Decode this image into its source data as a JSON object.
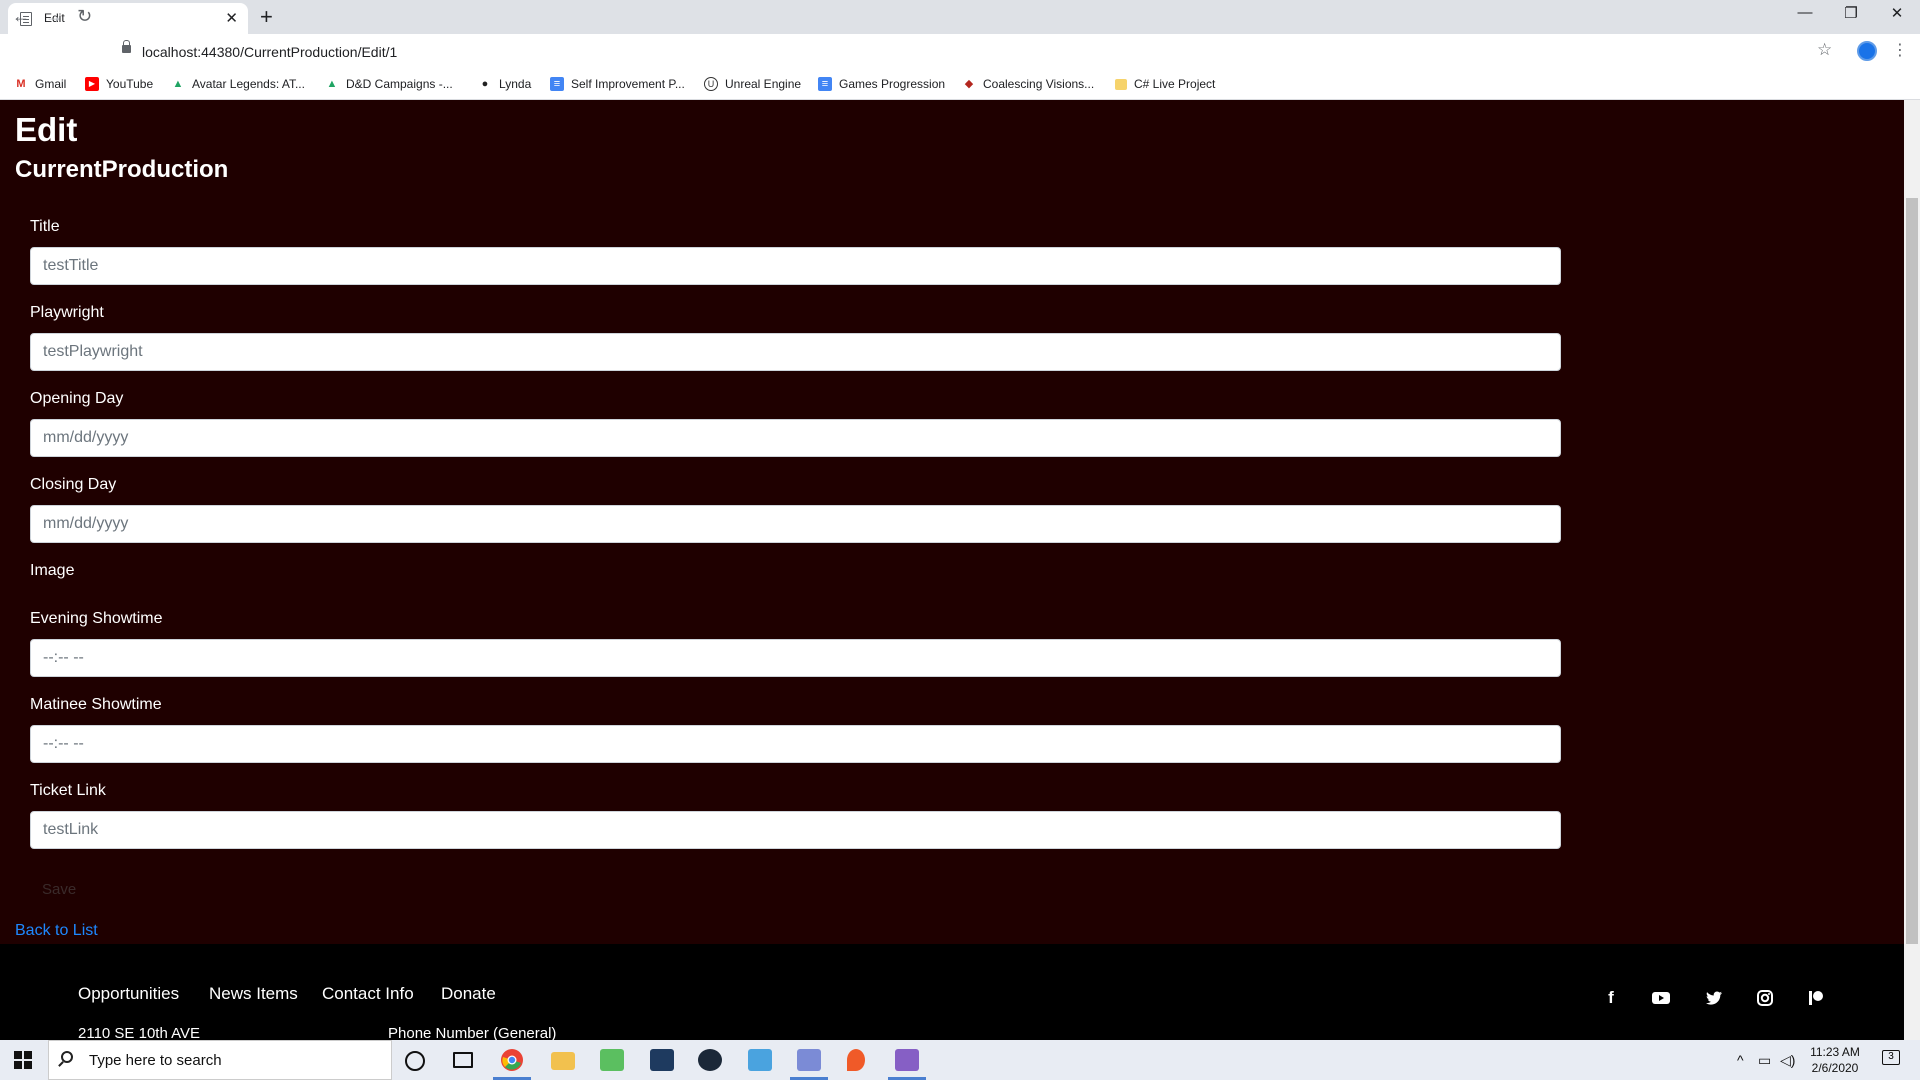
{
  "browser": {
    "tab_title": "Edit",
    "url": "localhost:44380/CurrentProduction/Edit/1",
    "bookmarks": [
      {
        "label": "Gmail",
        "icon": "gmail-icon",
        "color": "#d93025",
        "glyph": "M"
      },
      {
        "label": "YouTube",
        "icon": "youtube-icon",
        "color": "#ff0000",
        "glyph": "▶"
      },
      {
        "label": "Avatar Legends: AT...",
        "icon": "google-drive-icon",
        "color": "#1fa463",
        "glyph": "▲"
      },
      {
        "label": "D&D Campaigns -...",
        "icon": "google-drive-icon",
        "color": "#1fa463",
        "glyph": "▲"
      },
      {
        "label": "Lynda",
        "icon": "lynda-icon",
        "color": "#222222",
        "glyph": "●"
      },
      {
        "label": "Self Improvement P...",
        "icon": "google-docs-icon",
        "color": "#4285f4",
        "glyph": "≡"
      },
      {
        "label": "Unreal Engine",
        "icon": "unreal-icon",
        "color": "#333333",
        "glyph": "U"
      },
      {
        "label": "Games Progression",
        "icon": "google-docs-icon",
        "color": "#4285f4",
        "glyph": "≡"
      },
      {
        "label": "Coalescing Visions...",
        "icon": "bookmark-icon",
        "color": "#b3261e",
        "glyph": "◆"
      },
      {
        "label": "C# Live Project",
        "icon": "folder-icon",
        "color": "#f6d36b",
        "glyph": ""
      }
    ]
  },
  "page": {
    "title": "Edit",
    "subtitle": "CurrentProduction",
    "fields": {
      "title": {
        "label": "Title",
        "value": "testTitle"
      },
      "playwright": {
        "label": "Playwright",
        "value": "testPlaywright"
      },
      "opening_day": {
        "label": "Opening Day",
        "placeholder": "mm/dd/yyyy"
      },
      "closing_day": {
        "label": "Closing Day",
        "placeholder": "mm/dd/yyyy"
      },
      "image": {
        "label": "Image"
      },
      "evening_showtime": {
        "label": "Evening Showtime",
        "placeholder": "--:-- --"
      },
      "matinee_showtime": {
        "label": "Matinee Showtime",
        "placeholder": "--:-- --"
      },
      "ticket_link": {
        "label": "Ticket Link",
        "value": "testLink"
      }
    },
    "save_label": "Save",
    "back_label": "Back to List"
  },
  "footer": {
    "nav": [
      "Opportunities",
      "News Items",
      "Contact Info",
      "Donate"
    ],
    "address": "2110 SE 10th AVE",
    "phone_label": "Phone Number (General)",
    "social": [
      "facebook-icon",
      "youtube-icon",
      "twitter-icon",
      "instagram-icon",
      "patreon-icon"
    ]
  },
  "taskbar": {
    "search_placeholder": "Type here to search",
    "time": "11:23 AM",
    "date": "2/6/2020",
    "notification_count": "3"
  },
  "colors": {
    "page_background": "#1f0000",
    "link": "#1e88ff",
    "footer_background": "#000000"
  }
}
